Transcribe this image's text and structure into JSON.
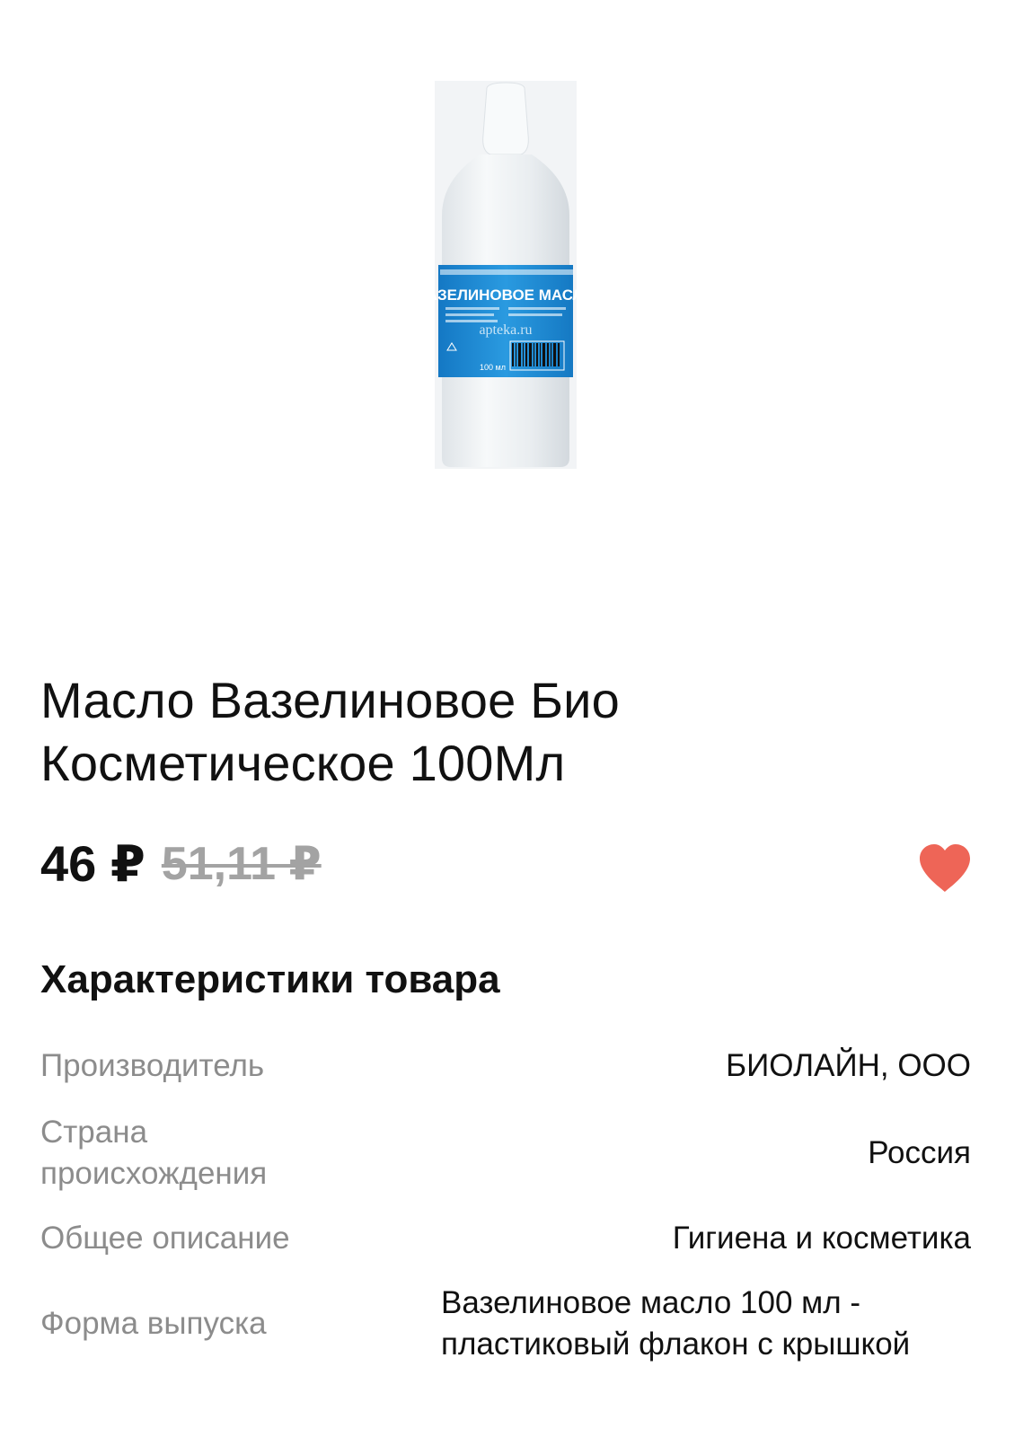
{
  "product": {
    "image_alt": "Вазелиновое масло bottle",
    "bottle_label_text": "ВАЗЕЛИНОВОЕ МАСЛО",
    "watermark": "apteka.ru",
    "bottle_volume": "100 мл",
    "title": "Масло Вазелиновое Био Косметическое 100Мл",
    "price_current": "46 ₽",
    "price_old": "51,11 ₽",
    "favorite_active": true
  },
  "specs": {
    "title": "Характеристики товара",
    "rows": [
      {
        "label": "Производитель",
        "value": "БИОЛАЙН, ООО"
      },
      {
        "label": "Страна происхождения",
        "value": "Россия"
      },
      {
        "label": "Общее описание",
        "value": "Гигиена и косметика"
      },
      {
        "label": "Форма выпуска",
        "value": "Вазелиновое масло 100 мл - пластиковый флакон с крышкой"
      }
    ]
  },
  "colors": {
    "heart": "#ee6557",
    "label_blue": "#1f8fd8",
    "muted_text": "#8c8c8c",
    "old_price": "#a3a3a3"
  }
}
